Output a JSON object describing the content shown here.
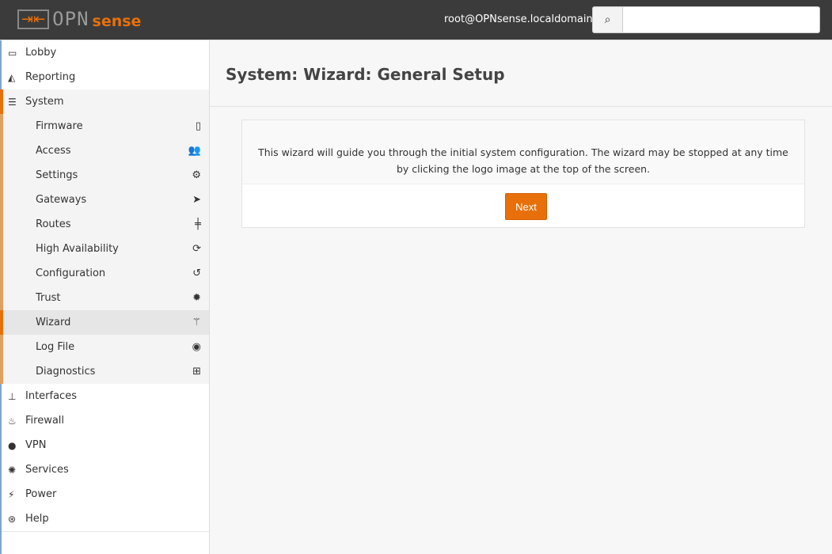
{
  "header": {
    "logo_text_opn": "OPN",
    "logo_text_sense": "sense",
    "user": "root@OPNsense.localdomain",
    "search_placeholder": ""
  },
  "sidebar": {
    "top": [
      {
        "label": "Lobby",
        "icon": "laptop-icon",
        "glyph": "▭"
      },
      {
        "label": "Reporting",
        "icon": "area-chart-icon",
        "glyph": "◭"
      }
    ],
    "system": {
      "label": "System",
      "icon": "server-icon",
      "glyph": "☰"
    },
    "system_items": [
      {
        "label": "Firmware",
        "icon": "tablet-icon",
        "glyph": "▯"
      },
      {
        "label": "Access",
        "icon": "users-icon",
        "glyph": "👥"
      },
      {
        "label": "Settings",
        "icon": "cogs-icon",
        "glyph": "⚙"
      },
      {
        "label": "Gateways",
        "icon": "location-arrow-icon",
        "glyph": "➤"
      },
      {
        "label": "Routes",
        "icon": "map-signs-icon",
        "glyph": "╪"
      },
      {
        "label": "High Availability",
        "icon": "refresh-icon",
        "glyph": "⟳"
      },
      {
        "label": "Configuration",
        "icon": "history-icon",
        "glyph": "↺"
      },
      {
        "label": "Trust",
        "icon": "certificate-icon",
        "glyph": "✹"
      },
      {
        "label": "Wizard",
        "icon": "magic-icon",
        "glyph": "⚚"
      },
      {
        "label": "Log File",
        "icon": "eye-icon",
        "glyph": "◉"
      },
      {
        "label": "Diagnostics",
        "icon": "medkit-icon",
        "glyph": "⊞"
      }
    ],
    "bottom": [
      {
        "label": "Interfaces",
        "icon": "sitemap-icon",
        "glyph": "⊥"
      },
      {
        "label": "Firewall",
        "icon": "fire-icon",
        "glyph": "♨"
      },
      {
        "label": "VPN",
        "icon": "globe-icon",
        "glyph": "●"
      },
      {
        "label": "Services",
        "icon": "cog-icon",
        "glyph": "✺"
      },
      {
        "label": "Power",
        "icon": "plug-icon",
        "glyph": "⚡"
      },
      {
        "label": "Help",
        "icon": "life-ring-icon",
        "glyph": "⊛"
      }
    ]
  },
  "page": {
    "title": "System: Wizard: General Setup",
    "description": "This wizard will guide you through the initial system configuration. The wizard may be stopped at any time by clicking the logo image at the top of the screen.",
    "next_label": "Next"
  }
}
